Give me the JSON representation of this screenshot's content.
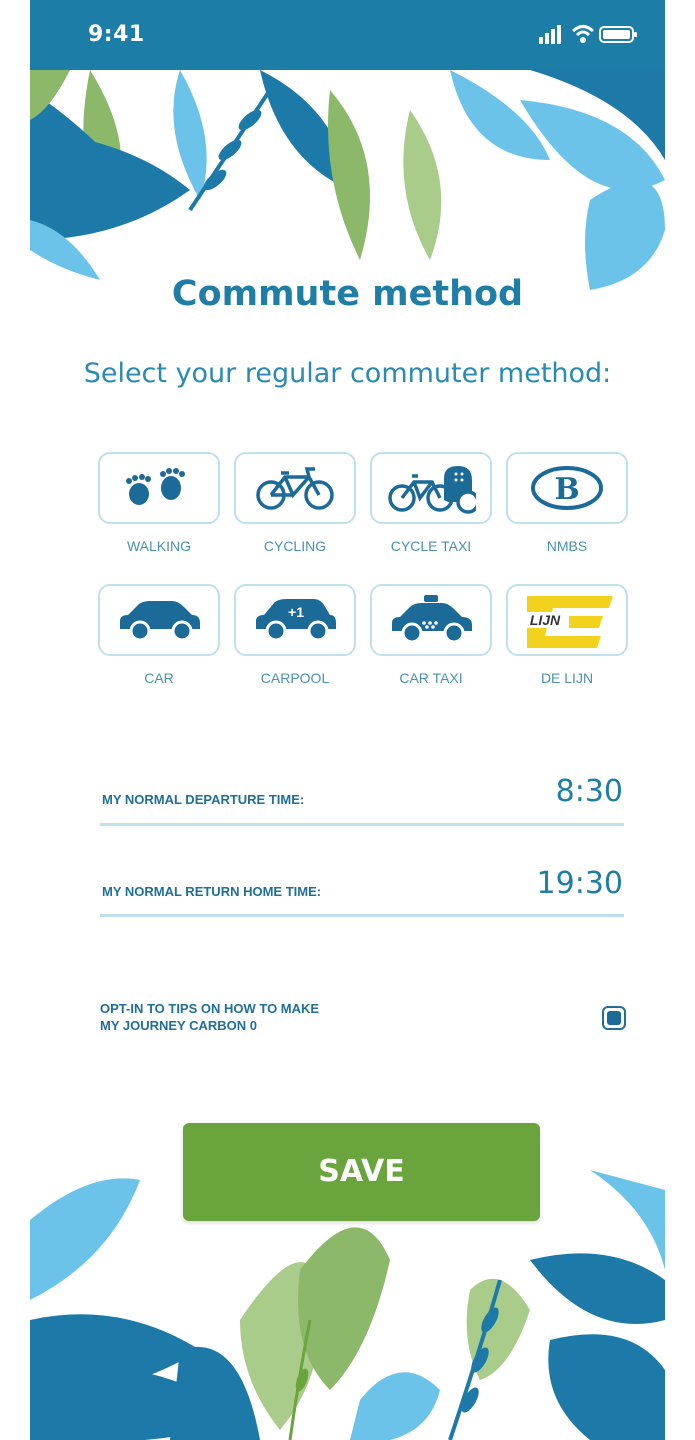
{
  "status_bar": {
    "time": "9:41",
    "icons": [
      "signal-icon",
      "wifi-icon",
      "battery-icon"
    ]
  },
  "page": {
    "title": "Commute method",
    "subtitle": "Select your regular commuter method:"
  },
  "methods": [
    {
      "label": "WALKING",
      "icon": "footprints-icon"
    },
    {
      "label": "CYCLING",
      "icon": "bicycle-icon"
    },
    {
      "label": "CYCLE TAXI",
      "icon": "cycle-taxi-icon"
    },
    {
      "label": "NMBS",
      "icon": "nmbs-logo-icon"
    },
    {
      "label": "CAR",
      "icon": "car-icon"
    },
    {
      "label": "CARPOOL",
      "icon": "carpool-icon",
      "badge": "+1"
    },
    {
      "label": "CAR TAXI",
      "icon": "taxi-icon"
    },
    {
      "label": "DE LIJN",
      "icon": "de-lijn-logo-icon",
      "logo_text": "LIJN"
    }
  ],
  "fields": {
    "departure": {
      "label": "MY NORMAL DEPARTURE TIME:",
      "value": "8:30"
    },
    "return": {
      "label": "MY NORMAL RETURN HOME TIME:",
      "value": "19:30"
    }
  },
  "optin": {
    "line1": "OPT-IN TO TIPS ON HOW TO MAKE",
    "line2": "MY JOURNEY CARBON 0",
    "checked": true
  },
  "actions": {
    "save_label": "SAVE"
  },
  "colors": {
    "primary_blue": "#1f7ea6",
    "status_bar": "#1c7da6",
    "tile_border": "#bfe0ee",
    "save_green": "#6aa43c",
    "leaf_dark_blue": "#1d7aa8",
    "leaf_light_blue": "#6cc3ea",
    "leaf_green": "#8cb86a"
  }
}
